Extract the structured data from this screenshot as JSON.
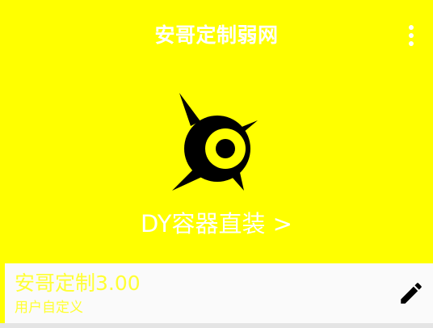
{
  "app_bar": {
    "title": "安哥定制弱网",
    "menu_icon": "more-vert-icon"
  },
  "hero": {
    "logo_icon": "compass-eye-logo-icon",
    "action_label": "DY容器直装 >"
  },
  "profile_card": {
    "title": "安哥定制3.00",
    "subtitle": "用户自定义",
    "edit_icon": "pencil-icon"
  },
  "colors": {
    "background": "#ffff00",
    "text_primary": "#ffffff",
    "card_background": "#fafafa",
    "card_text": "#ffff33",
    "icon_dark": "#000000"
  }
}
